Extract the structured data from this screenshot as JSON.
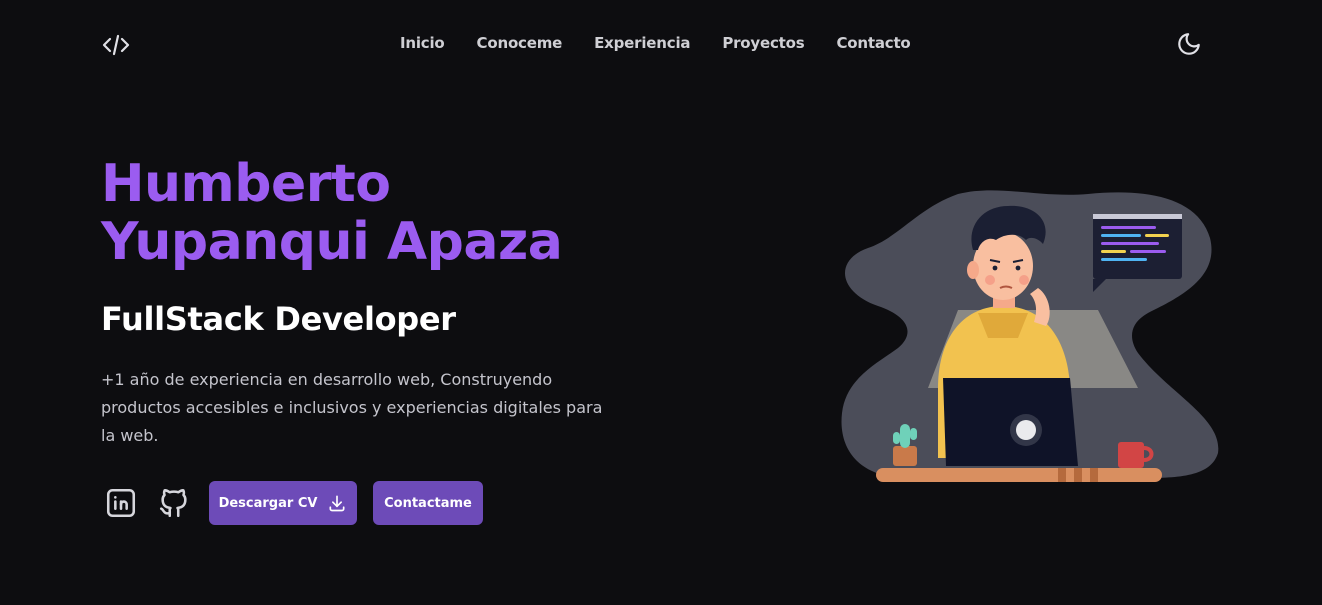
{
  "nav": {
    "logo_icon": "code-brackets-icon",
    "links": [
      "Inicio",
      "Conoceme",
      "Experiencia",
      "Proyectos",
      "Contacto"
    ],
    "theme_icon": "moon-icon"
  },
  "hero": {
    "name_line1": "Humberto",
    "name_line2": "Yupanqui Apaza",
    "role": "FullStack Developer",
    "description": "+1 año de experiencia en desarrollo web, Construyendo productos accesibles e inclusivos y experiencias digitales para la web.",
    "social_icons": [
      "linkedin-icon",
      "github-icon"
    ],
    "download_cv_label": "Descargar CV",
    "download_icon": "download-icon",
    "contact_label": "Contactame"
  },
  "colors": {
    "background": "#0d0d10",
    "accent": "#9b5cf0",
    "button": "#6d4bb8"
  }
}
